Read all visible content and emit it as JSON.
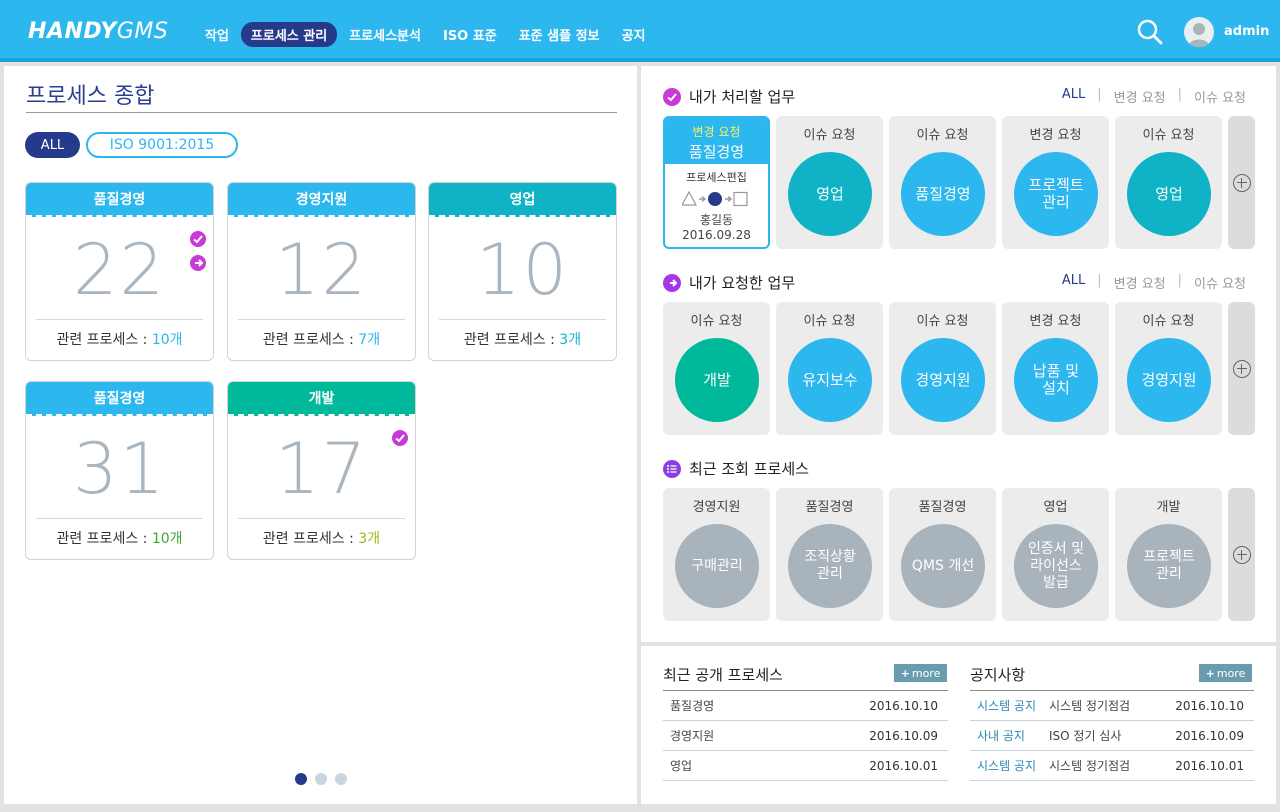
{
  "header": {
    "logo_bold": "HANDY",
    "logo_light": "GMS",
    "nav": [
      "작업",
      "프로세스 관리",
      "프로세스분석",
      "ISO 표준",
      "표준 샘플 정보",
      "공지"
    ],
    "active_nav": "프로세스 관리",
    "user": "admin"
  },
  "left": {
    "title": "프로세스 종합",
    "filters": [
      "ALL",
      "ISO 9001:2015"
    ],
    "card_prefix": "관련 프로세스 : ",
    "cards": [
      {
        "name": "품질경영",
        "number": "22",
        "count": "10개",
        "head_color": "#2db7ef",
        "count_color": "#2db7ef",
        "badges": [
          "check",
          "arrow"
        ]
      },
      {
        "name": "경영지원",
        "number": "12",
        "count": "7개",
        "head_color": "#2db7ef",
        "count_color": "#2db7ef",
        "badges": []
      },
      {
        "name": "영업",
        "number": "10",
        "count": "3개",
        "head_color": "#10b3c6",
        "count_color": "#10b3c6",
        "badges": []
      },
      {
        "name": "품질경영",
        "number": "31",
        "count": "10개",
        "head_color": "#2db7ef",
        "count_color": "#3fa535",
        "badges": []
      },
      {
        "name": "개발",
        "number": "17",
        "count": "3개",
        "head_color": "#00b89a",
        "count_color": "#9dbb1f",
        "badges": [
          "check"
        ]
      }
    ],
    "pages": 3,
    "current_page": 1
  },
  "my_tasks": {
    "title": "내가 처리할 업무",
    "links": [
      "ALL",
      "변경 요청",
      "이슈 요청"
    ],
    "selected": {
      "type": "변경 요청",
      "name": "품질경영",
      "sub": "프로세스편집",
      "person": "홍길동",
      "date": "2016.09.28"
    },
    "tiles": [
      {
        "label": "이슈 요청",
        "name": "영업",
        "color": "#10b3c6"
      },
      {
        "label": "이슈 요청",
        "name": "품질경영",
        "color": "#2db7ef"
      },
      {
        "label": "변경 요청",
        "name": "프로젝트 관리",
        "color": "#2db7ef"
      },
      {
        "label": "이슈 요청",
        "name": "영업",
        "color": "#10b3c6"
      }
    ]
  },
  "requested_tasks": {
    "title": "내가 요청한 업무",
    "links": [
      "ALL",
      "변경 요청",
      "이슈 요청"
    ],
    "tiles": [
      {
        "label": "이슈 요청",
        "name": "개발",
        "color": "#00b89a"
      },
      {
        "label": "이슈 요청",
        "name": "유지보수",
        "color": "#2db7ef"
      },
      {
        "label": "이슈 요청",
        "name": "경영지원",
        "color": "#2db7ef"
      },
      {
        "label": "변경 요청",
        "name": "납품 및 설치",
        "color": "#2db7ef"
      },
      {
        "label": "이슈 요청",
        "name": "경영지원",
        "color": "#2db7ef"
      }
    ]
  },
  "recent_views": {
    "title": "최근 조회 프로세스",
    "tiles": [
      {
        "label": "경영지원",
        "name": "구매관리",
        "color": "#a8b3bc"
      },
      {
        "label": "품질경영",
        "name": "조직상황 관리",
        "color": "#a8b3bc"
      },
      {
        "label": "품질경영",
        "name": "QMS 개선",
        "color": "#a8b3bc"
      },
      {
        "label": "영업",
        "name": "인증서 및 라이선스 발급",
        "color": "#a8b3bc"
      },
      {
        "label": "개발",
        "name": "프로젝트 관리",
        "color": "#a8b3bc"
      }
    ]
  },
  "recent_public": {
    "title": "최근 공개 프로세스",
    "more": "more",
    "rows": [
      {
        "name": "품질경영",
        "date": "2016.10.10"
      },
      {
        "name": "경영지원",
        "date": "2016.10.09"
      },
      {
        "name": "영업",
        "date": "2016.10.01"
      }
    ]
  },
  "notices": {
    "title": "공지사항",
    "more": "more",
    "rows": [
      {
        "category": "시스템 공지",
        "subject": "시스템 정기점검",
        "date": "2016.10.10"
      },
      {
        "category": "사내 공지",
        "subject": "ISO 정기 심사",
        "date": "2016.10.09"
      },
      {
        "category": "시스템 공지",
        "subject": "시스템 정기점검",
        "date": "2016.10.01"
      }
    ]
  }
}
